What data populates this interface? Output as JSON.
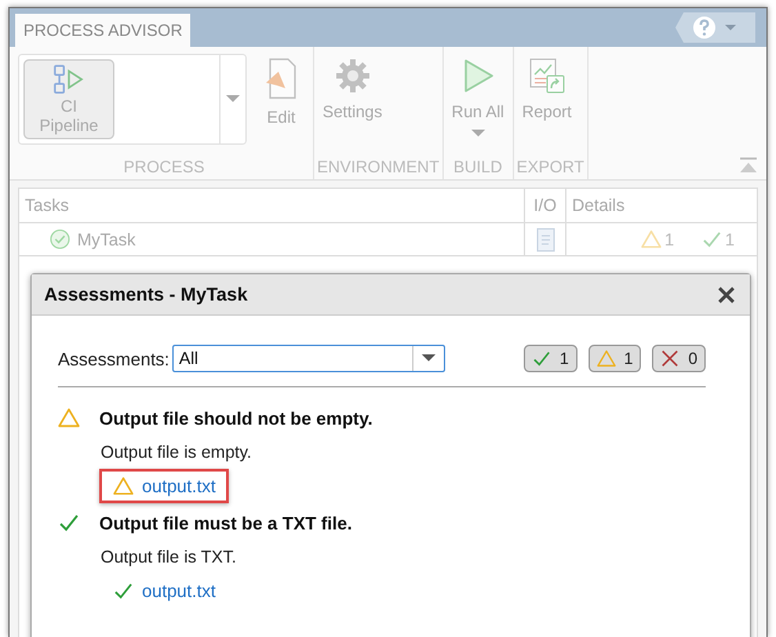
{
  "window": {
    "tab": {
      "label": "PROCESS ADVISOR",
      "selected": true
    }
  },
  "toolstrip": {
    "sections": [
      {
        "title": "PROCESS",
        "items": [
          {
            "kind": "gallery",
            "label": "CI Pipeline",
            "disabled": true
          },
          {
            "kind": "button",
            "label": "Edit",
            "disabled": true
          }
        ]
      },
      {
        "title": "ENVIRONMENT",
        "items": [
          {
            "kind": "button",
            "label": "Settings",
            "disabled": true
          }
        ]
      },
      {
        "title": "BUILD",
        "items": [
          {
            "kind": "split",
            "label": "Run All",
            "disabled": true
          }
        ]
      },
      {
        "title": "EXPORT",
        "items": [
          {
            "kind": "button",
            "label": "Report",
            "disabled": true
          }
        ]
      }
    ]
  },
  "table": {
    "columns": [
      "Tasks",
      "I/O",
      "Details"
    ],
    "rows": [
      {
        "task": "MyTask",
        "passed": true,
        "warnings": "1",
        "passes": "1"
      }
    ]
  },
  "dialog": {
    "title": "Assessments - MyTask",
    "filter": {
      "label": "Assessments:",
      "value": "All"
    },
    "counts": [
      {
        "kind": "pass",
        "count": "1"
      },
      {
        "kind": "warning",
        "count": "1"
      },
      {
        "kind": "fail",
        "count": "0"
      }
    ],
    "assessments": [
      {
        "kind": "warning",
        "title": "Output file should not be empty.",
        "detail": "Output file is empty.",
        "file": {
          "name": "output.txt",
          "kind": "warning",
          "highlighted": true
        }
      },
      {
        "kind": "pass",
        "title": "Output file must be a TXT file.",
        "detail": "Output file is TXT.",
        "file": {
          "name": "output.txt",
          "kind": "pass",
          "highlighted": false
        }
      }
    ]
  }
}
